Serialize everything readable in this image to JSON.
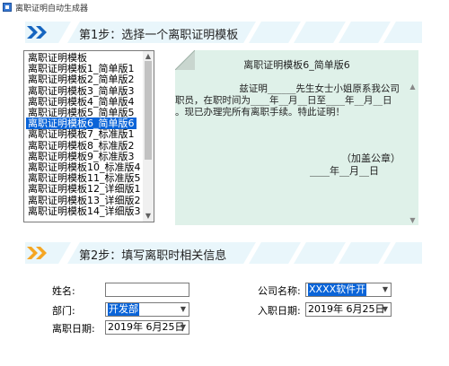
{
  "window": {
    "title": "离职证明自动生成器"
  },
  "step1": {
    "label": "第1步：选择一个离职证明模板"
  },
  "step2": {
    "label": "第2步：填写离职时相关信息"
  },
  "templates": {
    "items": [
      "离职证明模板",
      "离职证明模板1_简单版1",
      "离职证明模板2_简单版2",
      "离职证明模板3_简单版3",
      "离职证明模板4_简单版4",
      "离职证明模板5_简单版5",
      "离职证明模板6_简单版6",
      "离职证明模板7_标准版1",
      "离职证明模板8_标准版2",
      "离职证明模板9_标准版3",
      "离职证明模板10_标准版4",
      "离职证明模板11_标准版5",
      "离职证明模板12_详细版1",
      "离职证明模板13_详细版2",
      "离职证明模板14_详细版3"
    ],
    "selected_index": 6
  },
  "preview": {
    "title": "离职证明模板6_简单版6",
    "line1": "    兹证明______先生女士小姐原系我公司",
    "line2": "职员，在职时间为____年__月__日至____年__月__日",
    "line3": "。现已办理完所有离职手续。特此证明！",
    "seal": "（加盖公章）",
    "date": "____年__月__日"
  },
  "form": {
    "name_label": "姓名:",
    "name_value": "",
    "company_label": "公司名称:",
    "company_value": "XXXX软件开",
    "department_label": "部门:",
    "department_value": "开发部",
    "hire_date_label": "入职日期:",
    "hire_date_value": "2019年 6月25日",
    "leave_date_label": "离职日期:",
    "leave_date_value": "2019年 6月25日"
  }
}
